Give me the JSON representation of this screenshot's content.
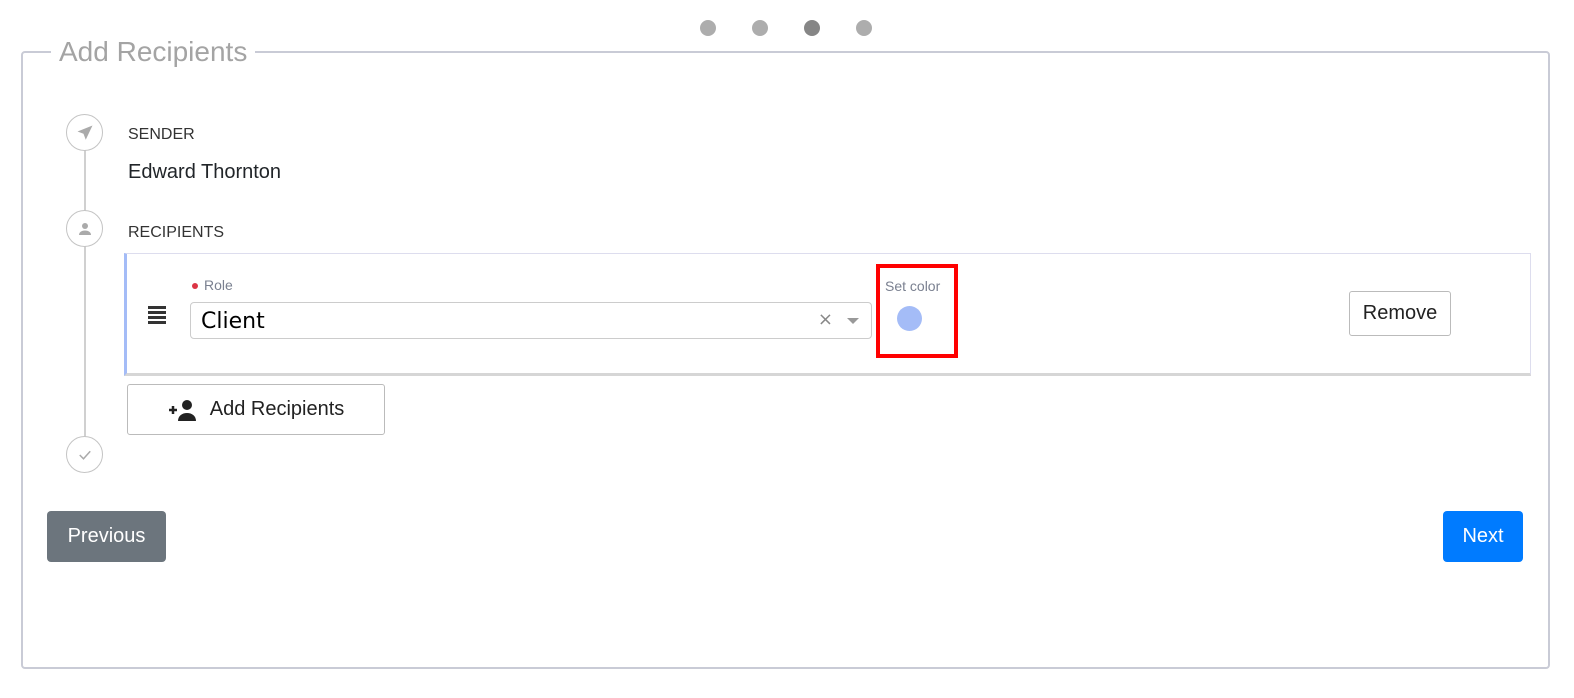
{
  "carousel": {
    "count": 4,
    "active_index": 2
  },
  "panel": {
    "title": "Add Recipients"
  },
  "sender": {
    "label": "SENDER",
    "name": "Edward Thornton"
  },
  "recipients": {
    "label": "RECIPIENTS",
    "items": [
      {
        "role_label": "Role",
        "role_value": "Client",
        "clear_symbol": "×",
        "color_label": "Set color",
        "color": "#a4bcf7",
        "remove_label": "Remove"
      }
    ],
    "add_label": "Add Recipients"
  },
  "nav": {
    "previous": "Previous",
    "next": "Next"
  },
  "colors": {
    "primary": "#007bff",
    "secondary": "#6c757d",
    "highlight": "#ff0000"
  }
}
